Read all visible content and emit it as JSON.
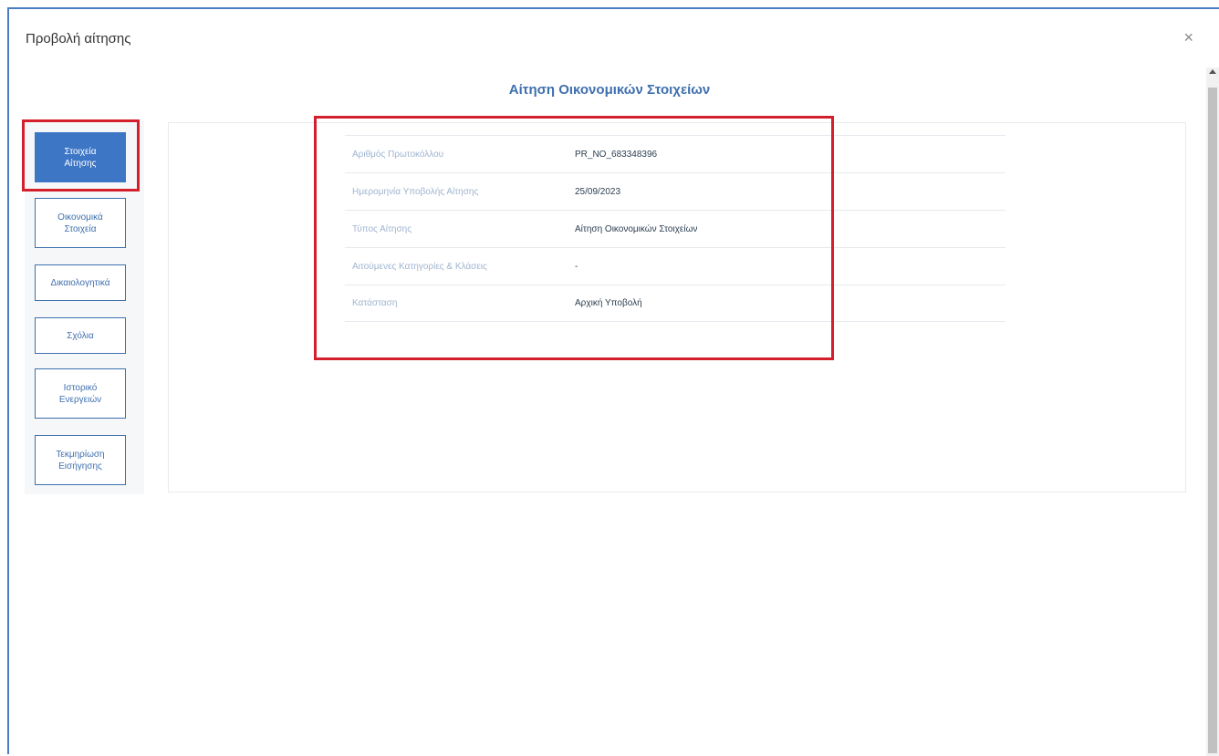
{
  "modal": {
    "title": "Προβολή αίτησης",
    "close_label": "×"
  },
  "page_heading": "Αίτηση Οικονομικών Στοιχείων",
  "sidebar": {
    "items": [
      {
        "label": "Στοιχεία\nΑίτησης",
        "active": true
      },
      {
        "label": "Οικονομικά\nΣτοιχεία",
        "active": false
      },
      {
        "label": "Δικαιολογητικά",
        "active": false
      },
      {
        "label": "Σχόλια",
        "active": false
      },
      {
        "label": "Ιστορικό\nΕνεργειών",
        "active": false
      },
      {
        "label": "Τεκμηρίωση\nΕισήγησης",
        "active": false
      }
    ]
  },
  "details": {
    "rows": [
      {
        "label": "Αριθμός Πρωτοκόλλου",
        "value": "PR_NO_683348396"
      },
      {
        "label": "Ημερομηνία Υποβολής Αίτησης",
        "value": "25/09/2023"
      },
      {
        "label": "Τύπος Αίτησης",
        "value": "Αίτηση Οικονομικών Στοιχείων"
      },
      {
        "label": "Αιτούμενες Κατηγορίες & Κλάσεις",
        "value": "-"
      },
      {
        "label": "Κατάσταση",
        "value": "Αρχική Υποβολή"
      }
    ]
  },
  "colors": {
    "accent": "#3e76c6",
    "highlight": "#d4202c",
    "label_text": "#9fb4cf"
  }
}
